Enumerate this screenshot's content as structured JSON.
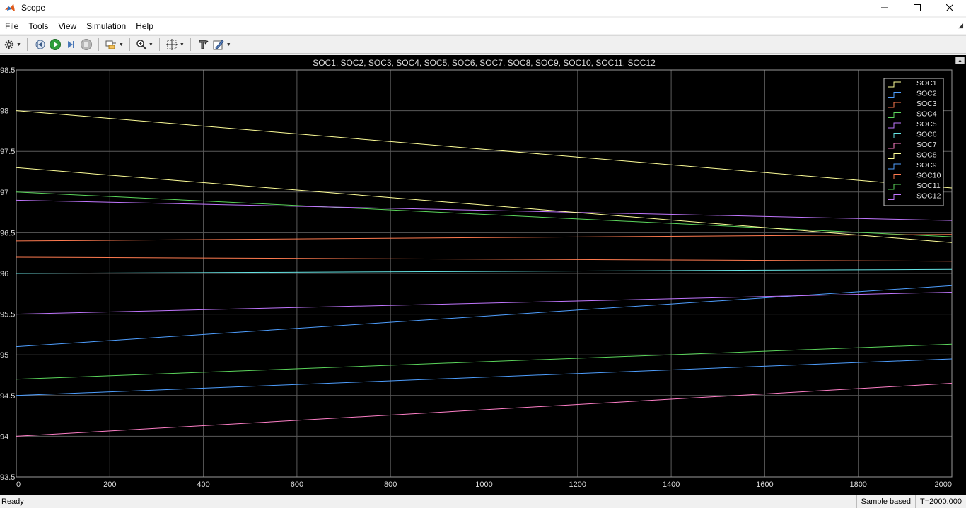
{
  "window": {
    "title": "Scope"
  },
  "menu": [
    "File",
    "Tools",
    "View",
    "Simulation",
    "Help"
  ],
  "toolbar": {
    "icons": [
      "settings-icon",
      "step-back-icon",
      "run-icon",
      "step-forward-icon",
      "stop-icon",
      "highlight-block-icon",
      "zoom-icon",
      "fit-axes-icon",
      "cursor-measure-icon",
      "style-icon"
    ]
  },
  "status": {
    "left": "Ready",
    "sample": "Sample based",
    "time": "T=2000.000"
  },
  "colors": {
    "plot_bg": "#000000",
    "grid": "#5a5a5a",
    "axis_text": "#dcdcdc"
  },
  "chart_data": {
    "type": "line",
    "title": "SOC1, SOC2, SOC3, SOC4, SOC5, SOC6, SOC7, SOC8, SOC9, SOC10, SOC11, SOC12",
    "xlim": [
      0,
      2000
    ],
    "ylim": [
      93.5,
      98.5
    ],
    "xticks": [
      "0",
      "200",
      "400",
      "600",
      "800",
      "1000",
      "1200",
      "1400",
      "1600",
      "1800",
      "2000"
    ],
    "yticks": [
      "93.5",
      "94",
      "94.5",
      "95",
      "95.5",
      "96",
      "96.5",
      "97",
      "97.5",
      "98",
      "98.5"
    ],
    "grid": true,
    "legend_position": "top-right",
    "series": [
      {
        "name": "SOC1",
        "color": "#ffff99",
        "x": [
          0,
          2000
        ],
        "y": [
          98.0,
          97.05
        ]
      },
      {
        "name": "SOC2",
        "color": "#4f9fff",
        "x": [
          0,
          2000
        ],
        "y": [
          95.1,
          95.85
        ]
      },
      {
        "name": "SOC3",
        "color": "#ff7b50",
        "x": [
          0,
          2000
        ],
        "y": [
          96.2,
          96.15
        ]
      },
      {
        "name": "SOC4",
        "color": "#5cd65c",
        "x": [
          0,
          2000
        ],
        "y": [
          97.0,
          96.45
        ]
      },
      {
        "name": "SOC5",
        "color": "#c177ff",
        "x": [
          0,
          2000
        ],
        "y": [
          96.9,
          96.65
        ]
      },
      {
        "name": "SOC6",
        "color": "#66e5e5",
        "x": [
          0,
          2000
        ],
        "y": [
          96.0,
          96.05
        ]
      },
      {
        "name": "SOC7",
        "color": "#ff80c8",
        "x": [
          0,
          2000
        ],
        "y": [
          94.0,
          94.65
        ]
      },
      {
        "name": "SOC8",
        "color": "#ffff99",
        "x": [
          0,
          2000
        ],
        "y": [
          97.3,
          96.38
        ]
      },
      {
        "name": "SOC9",
        "color": "#4f9fff",
        "x": [
          0,
          2000
        ],
        "y": [
          94.5,
          94.95
        ]
      },
      {
        "name": "SOC10",
        "color": "#ff7b50",
        "x": [
          0,
          2000
        ],
        "y": [
          96.4,
          96.48
        ]
      },
      {
        "name": "SOC11",
        "color": "#5cd65c",
        "x": [
          0,
          2000
        ],
        "y": [
          94.7,
          95.13
        ]
      },
      {
        "name": "SOC12",
        "color": "#c177ff",
        "x": [
          0,
          2000
        ],
        "y": [
          95.5,
          95.77
        ]
      }
    ]
  }
}
